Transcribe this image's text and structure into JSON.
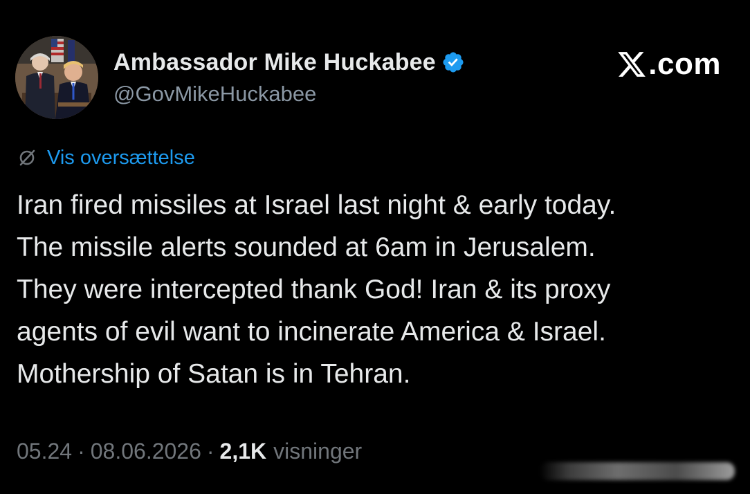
{
  "brand": {
    "text": ".com",
    "logo_icon": "x-logo-icon"
  },
  "author": {
    "display_name": "Ambassador Mike Huckabee",
    "handle": "@GovMikeHuckabee",
    "verified_icon": "verified-badge-icon",
    "verified_color": "#1d9bf0",
    "avatar": "avatar-photo"
  },
  "translate": {
    "icon": "globe-icon",
    "label": "Vis oversættelse"
  },
  "tweet": {
    "lines": [
      "Iran fired missiles at Israel last night & early today.",
      "The missile alerts sounded at 6am in Jerusalem.",
      "They were intercepted thank God!  Iran & its proxy",
      "agents of evil want to incinerate America & Israel.",
      "Mothership of Satan is in Tehran."
    ]
  },
  "meta": {
    "time": "05.24",
    "separator": "·",
    "date": "08.06.2026",
    "views_count": "2,1K",
    "views_label": "visninger"
  },
  "colors": {
    "background": "#000000",
    "text": "#e7e9ea",
    "secondary_text": "#71767b",
    "handle_text": "#8b98a5",
    "link": "#1d9bf0"
  }
}
